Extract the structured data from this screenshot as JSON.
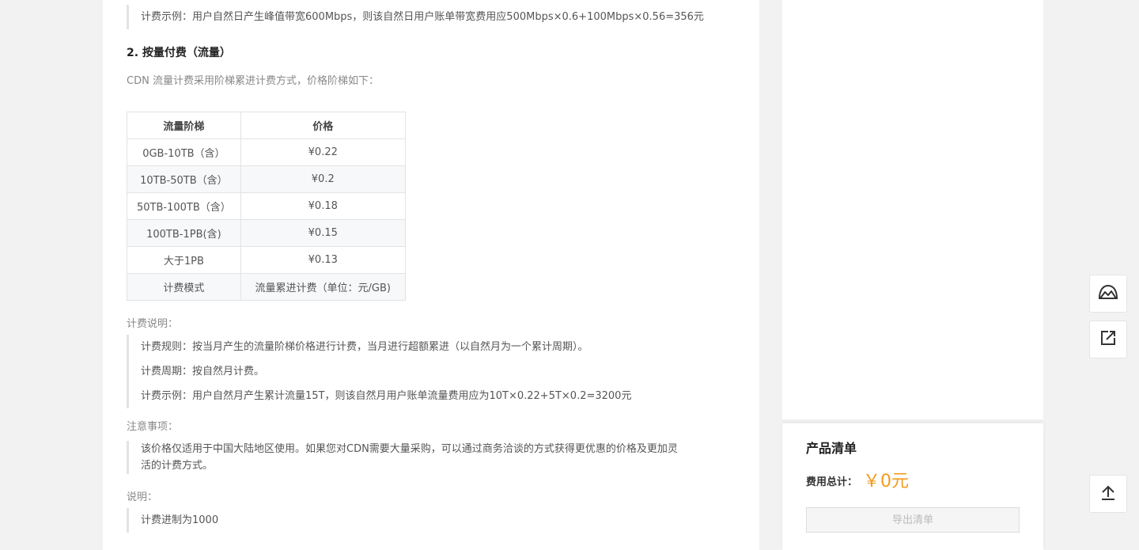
{
  "top_quote": "计费示例：用户自然日产生峰值带宽600Mbps，则该自然日用户账单带宽费用应500Mbps×0.6+100Mbps×0.56=356元",
  "section2_title": "2. 按量付费（流量）",
  "section2_intro": "CDN 流量计费采用阶梯累进计费方式，价格阶梯如下：",
  "table": {
    "headers": [
      "流量阶梯",
      "价格"
    ],
    "rows": [
      [
        "0GB-10TB（含）",
        "¥0.22"
      ],
      [
        "10TB-50TB（含）",
        "¥0.2"
      ],
      [
        "50TB-100TB（含）",
        "¥0.18"
      ],
      [
        "100TB-1PB(含)",
        "¥0.15"
      ],
      [
        "大于1PB",
        "¥0.13"
      ],
      [
        "计费模式",
        "流量累进计费（单位：元/GB)"
      ]
    ]
  },
  "billing_label": "计费说明：",
  "billing_items": [
    "计费规则：按当月产生的流量阶梯价格进行计费，当月进行超额累进（以自然月为一个累计周期）。",
    "计费周期：按自然月计费。",
    "计费示例：用户自然月产生累计流量15T，则该自然月用户账单流量费用应为10T×0.22+5T×0.2=3200元"
  ],
  "notes_label": "注意事项：",
  "notes_line1": "该价格仅适用于中国大陆地区使用。如果您对CDN需要大量采购，可以通过商务洽谈的方式获得更优惠的价格及更加灵",
  "notes_line2": "活的计费方式。",
  "explain_label": "说明：",
  "explain_text": "计费进制为1000",
  "cart": {
    "title": "产品清单",
    "total_label": "费用总计：",
    "total_value": "￥0元",
    "export_label": "导出清单"
  },
  "colors": {
    "accent_price": "#f39b1a"
  },
  "float_buttons": [
    "mountain-icon",
    "share-icon",
    "back-to-top-icon"
  ]
}
